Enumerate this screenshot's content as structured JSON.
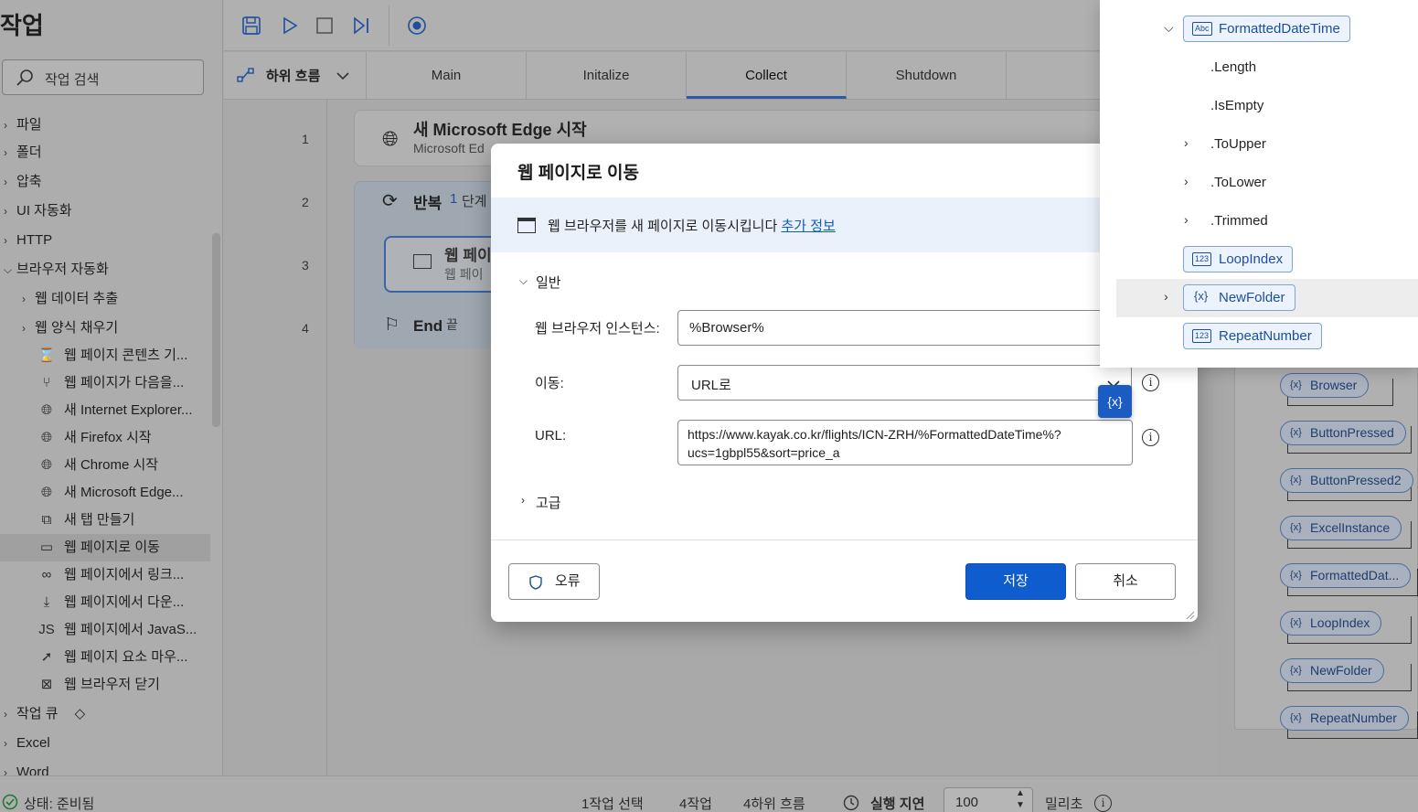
{
  "left_pane": {
    "title": "작업",
    "search_placeholder": "작업 검색",
    "items": [
      {
        "label": "파일",
        "level": 0,
        "icon": ""
      },
      {
        "label": "폴더",
        "level": 0,
        "icon": ""
      },
      {
        "label": "압축",
        "level": 0,
        "icon": ""
      },
      {
        "label": "UI 자동화",
        "level": 0,
        "icon": ""
      },
      {
        "label": "HTTP",
        "level": 0,
        "icon": ""
      },
      {
        "label": "브라우저 자동화",
        "level": 0,
        "icon": ""
      },
      {
        "label": "웹 데이터 추출",
        "level": 1,
        "icon": ""
      },
      {
        "label": "웹 양식 채우기",
        "level": 1,
        "icon": ""
      },
      {
        "label": "웹 페이지 콘텐츠 기...",
        "level": 2,
        "icon": "hourglass-icon"
      },
      {
        "label": "웹 페이지가 다음을...",
        "level": 2,
        "icon": "branch-icon"
      },
      {
        "label": "새 Internet Explorer...",
        "level": 2,
        "icon": "globe-icon"
      },
      {
        "label": "새 Firefox 시작",
        "level": 2,
        "icon": "globe-icon"
      },
      {
        "label": "새 Chrome 시작",
        "level": 2,
        "icon": "globe-icon"
      },
      {
        "label": "새 Microsoft Edge...",
        "level": 2,
        "icon": "globe-icon"
      },
      {
        "label": "새 탭 만들기",
        "level": 2,
        "icon": "new-tab-icon"
      },
      {
        "label": "웹 페이지로 이동",
        "level": 2,
        "icon": "browser-window-icon"
      },
      {
        "label": "웹 페이지에서 링크...",
        "level": 2,
        "icon": "link-icon"
      },
      {
        "label": "웹 페이지에서 다운...",
        "level": 2,
        "icon": "download-icon"
      },
      {
        "label": "웹 페이지에서 JavaS...",
        "level": 2,
        "icon": "js-icon"
      },
      {
        "label": "웹 페이지 요소 마우...",
        "level": 2,
        "icon": "cursor-icon"
      },
      {
        "label": "웹 브라우저 닫기",
        "level": 2,
        "icon": "close-box-icon"
      },
      {
        "label": "작업 큐",
        "level": 0,
        "icon": "diamond-icon"
      },
      {
        "label": "Excel",
        "level": 0,
        "icon": ""
      },
      {
        "label": "Word",
        "level": 0,
        "icon": ""
      }
    ]
  },
  "toolbar": {
    "subflow_label": "하위 흐름"
  },
  "tabs": [
    "Main",
    "Initalize",
    "Collect",
    "Shutdown"
  ],
  "active_tab": "Collect",
  "flow": {
    "line_numbers": [
      "1",
      "2",
      "3",
      "4"
    ],
    "step1_title": "새 Microsoft Edge 시작",
    "step1_sub": "Microsoft Ed",
    "step2_title": "반복",
    "step2_count": "1",
    "step2_suffix": "단계",
    "step3_title": "웹 페이",
    "step3_sub": "웹 페이",
    "step4_title": "End",
    "step4_suffix": "끝"
  },
  "dialog": {
    "title": "웹 페이지로 이동",
    "info_text": "웹 브라우저를 새 페이지로 이동시킵니다",
    "info_link": "추가 정보",
    "section_general": "일반",
    "label_instance": "웹 브라우저 인스턴스:",
    "value_instance": "%Browser%",
    "label_navigate": "이동:",
    "value_navigate": "URL로",
    "label_url": "URL:",
    "value_url_line1": "https://www.kayak.co.kr/flights/ICN-ZRH/%FormattedDateTime%?",
    "value_url_line2": "ucs=1gbpl55&sort=price_a",
    "section_advanced": "고급",
    "btn_error": "오류",
    "btn_save": "저장",
    "btn_cancel": "취소",
    "var_badge": "{x}"
  },
  "var_popup": {
    "rows": [
      {
        "label": "FormattedDateTime",
        "type": "Abc",
        "tagged": true,
        "expand": "open"
      },
      {
        "label": ".Length",
        "tagged": false,
        "expand": "none"
      },
      {
        "label": ".IsEmpty",
        "tagged": false,
        "expand": "none"
      },
      {
        "label": ".ToUpper",
        "tagged": false,
        "expand": "closed"
      },
      {
        "label": ".ToLower",
        "tagged": false,
        "expand": "closed"
      },
      {
        "label": ".Trimmed",
        "tagged": false,
        "expand": "closed"
      },
      {
        "label": "LoopIndex",
        "type": "123",
        "tagged": true,
        "expand": "none"
      },
      {
        "label": "NewFolder",
        "type": "{x}",
        "tagged": true,
        "expand": "closed"
      },
      {
        "label": "RepeatNumber",
        "type": "123",
        "tagged": true,
        "expand": "none"
      }
    ]
  },
  "variables_panel": {
    "items": [
      "Browser",
      "ButtonPressed",
      "ButtonPressed2",
      "ExcelInstance",
      "FormattedDat...",
      "LoopIndex",
      "NewFolder",
      "RepeatNumber"
    ]
  },
  "status_bar": {
    "status": "상태: 준비됨",
    "selected": "1작업 선택",
    "actions": "4작업",
    "subflows": "4하위 흐름",
    "delay_label": "실행 지연",
    "delay_value": "100",
    "delay_unit": "밀리초"
  }
}
